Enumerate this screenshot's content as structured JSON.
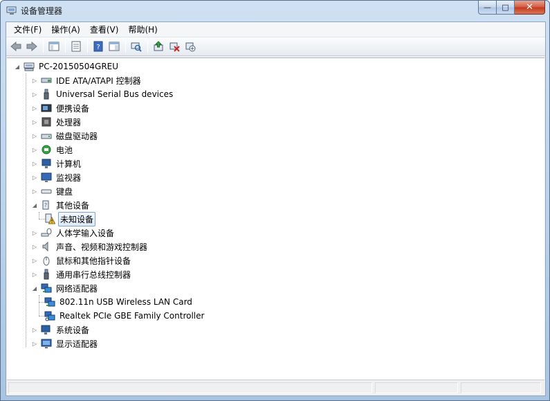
{
  "window": {
    "title": "设备管理器",
    "caption_buttons": {
      "minimize": "—",
      "maximize": "□",
      "close": "✕"
    }
  },
  "menubar": {
    "items": [
      {
        "label": "文件(F)"
      },
      {
        "label": "操作(A)"
      },
      {
        "label": "查看(V)"
      },
      {
        "label": "帮助(H)"
      }
    ]
  },
  "toolbar": {
    "buttons": [
      {
        "icon": "back-arrow-icon"
      },
      {
        "icon": "forward-arrow-icon"
      },
      {
        "icon": "show-hide-console-tree-icon"
      },
      {
        "icon": "properties-icon"
      },
      {
        "icon": "help-icon"
      },
      {
        "icon": "action-pane-icon"
      },
      {
        "icon": "scan-hardware-changes-icon"
      },
      {
        "icon": "update-driver-icon"
      },
      {
        "icon": "uninstall-icon"
      },
      {
        "icon": "disable-device-icon"
      }
    ]
  },
  "tree": {
    "root": "PC-20150504GREU",
    "categories": [
      {
        "label": "IDE ATA/ATAPI 控制器",
        "icon": "ide-controller-icon",
        "expanded": false
      },
      {
        "label": "Universal Serial Bus devices",
        "icon": "usb-device-icon",
        "expanded": false
      },
      {
        "label": "便携设备",
        "icon": "portable-device-icon",
        "expanded": false
      },
      {
        "label": "处理器",
        "icon": "processor-icon",
        "expanded": false
      },
      {
        "label": "磁盘驱动器",
        "icon": "disk-drive-icon",
        "expanded": false
      },
      {
        "label": "电池",
        "icon": "battery-icon",
        "expanded": false
      },
      {
        "label": "计算机",
        "icon": "computer-icon",
        "expanded": false
      },
      {
        "label": "监视器",
        "icon": "monitor-icon",
        "expanded": false
      },
      {
        "label": "键盘",
        "icon": "keyboard-icon",
        "expanded": false
      },
      {
        "label": "其他设备",
        "icon": "other-devices-icon",
        "expanded": true,
        "children": [
          {
            "label": "未知设备",
            "icon": "unknown-device-warning-icon",
            "selected": true
          }
        ]
      },
      {
        "label": "人体学输入设备",
        "icon": "hid-icon",
        "expanded": false
      },
      {
        "label": "声音、视频和游戏控制器",
        "icon": "sound-icon",
        "expanded": false
      },
      {
        "label": "鼠标和其他指针设备",
        "icon": "mouse-icon",
        "expanded": false
      },
      {
        "label": "通用串行总线控制器",
        "icon": "usb-controller-icon",
        "expanded": false
      },
      {
        "label": "网络适配器",
        "icon": "network-adapter-icon",
        "expanded": true,
        "children": [
          {
            "label": "802.11n USB Wireless LAN Card",
            "icon": "network-adapter-icon"
          },
          {
            "label": "Realtek PCIe GBE Family Controller",
            "icon": "network-adapter-icon"
          }
        ]
      },
      {
        "label": "系统设备",
        "icon": "system-device-icon",
        "expanded": false
      },
      {
        "label": "显示适配器",
        "icon": "display-adapter-icon",
        "expanded": false
      }
    ]
  },
  "colors": {
    "titlebar": "#b9d1ea",
    "selection_border": "#7da2ce",
    "close_button": "#c4381c",
    "warning": "#f2c037"
  }
}
